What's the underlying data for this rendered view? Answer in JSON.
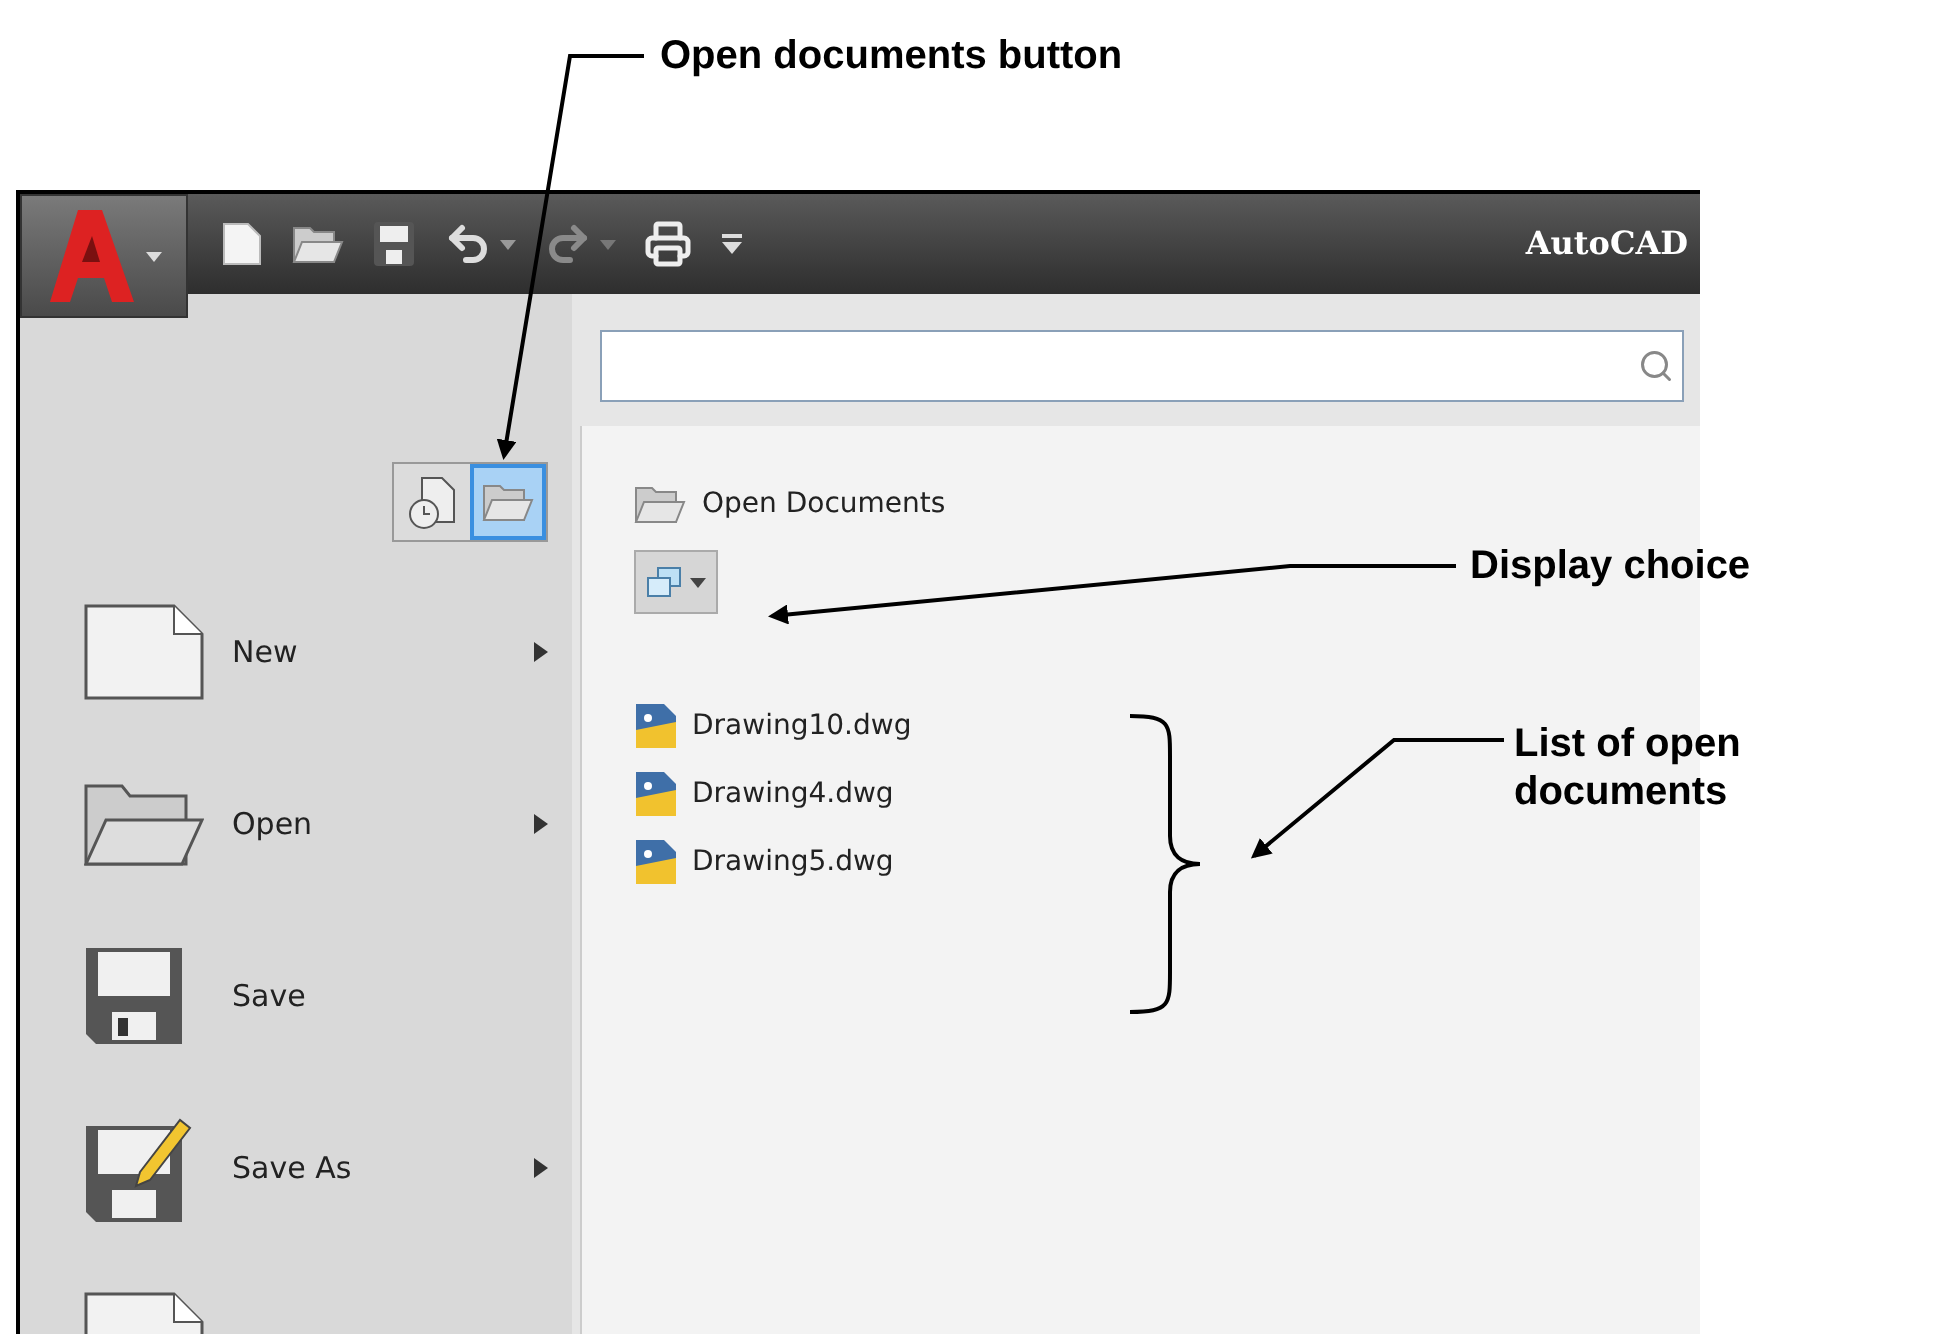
{
  "callouts": [
    {
      "text": "Open documents button"
    },
    {
      "text": "Display choice"
    },
    {
      "text": "List of open documents"
    }
  ],
  "window": {
    "title": "AutoCAD"
  },
  "quick_access_toolbar": [
    {
      "kind": "new"
    },
    {
      "kind": "open"
    },
    {
      "kind": "save"
    },
    {
      "kind": "undo"
    },
    {
      "kind": "redo"
    },
    {
      "kind": "print"
    },
    {
      "kind": "more"
    }
  ],
  "view_buttons": [
    {
      "kind": "recent",
      "selected": false
    },
    {
      "kind": "open",
      "selected": true
    }
  ],
  "menu": [
    {
      "kind": "new",
      "label": "New",
      "submenu": true
    },
    {
      "kind": "open",
      "label": "Open",
      "submenu": true
    },
    {
      "kind": "save",
      "label": "Save",
      "submenu": false
    },
    {
      "kind": "saveas",
      "label": "Save As",
      "submenu": true
    },
    {
      "kind": "new",
      "submenu": false
    }
  ],
  "panel": {
    "heading": "Open Documents",
    "documents": [
      {
        "name": "Drawing10.dwg"
      },
      {
        "name": "Drawing4.dwg"
      },
      {
        "name": "Drawing5.dwg"
      }
    ]
  }
}
